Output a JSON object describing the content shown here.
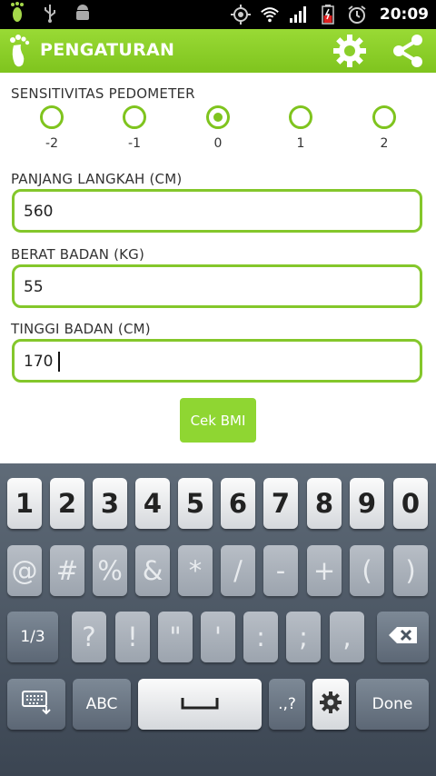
{
  "status_bar": {
    "time": "20:09"
  },
  "action_bar": {
    "title": "PENGATURAN",
    "accent_color": "#8fd632"
  },
  "pedometer": {
    "label": "SENSITIVITAS PEDOMETER",
    "options": [
      "-2",
      "-1",
      "0",
      "1",
      "2"
    ],
    "selected": "0"
  },
  "step_length": {
    "label": "PANJANG LANGKAH (CM)",
    "value": "560"
  },
  "weight": {
    "label": "BERAT BADAN (KG)",
    "value": "55"
  },
  "height": {
    "label": "TINGGI BADAN (CM)",
    "value": "170"
  },
  "bmi_button": {
    "label": "Cek BMI"
  },
  "keyboard": {
    "number_row": [
      "1",
      "2",
      "3",
      "4",
      "5",
      "6",
      "7",
      "8",
      "9",
      "0"
    ],
    "symbol_row": [
      "@",
      "#",
      "%",
      "&",
      "*",
      "/",
      "-",
      "+",
      "(",
      ")"
    ],
    "third_row": {
      "page": "1/3",
      "keys": [
        "?",
        "!",
        "\"",
        "'",
        ":",
        ";",
        ","
      ]
    },
    "bottom_row": {
      "abc": "ABC",
      "punct": ".,?",
      "done": "Done"
    }
  }
}
